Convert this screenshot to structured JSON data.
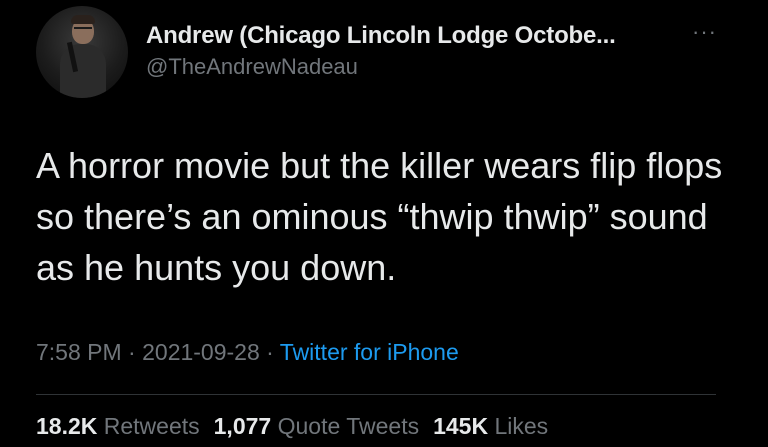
{
  "author": {
    "display_name": "Andrew (Chicago Lincoln Lodge Octobe...",
    "handle": "@TheAndrewNadeau"
  },
  "more_icon": "more-horizontal-icon",
  "tweet": {
    "text": "A horror movie but the killer wears flip flops so there’s an ominous “thwip thwip” sound as he hunts you down."
  },
  "meta": {
    "time": "7:58 PM",
    "sep1": " · ",
    "date": "2021-09-28",
    "sep2": " · ",
    "source": "Twitter for iPhone"
  },
  "stats": {
    "retweets_count": "18.2K",
    "retweets_label": "Retweets",
    "quotes_count": "1,077",
    "quotes_label": "Quote Tweets",
    "likes_count": "145K",
    "likes_label": "Likes"
  },
  "colors": {
    "background": "#000000",
    "primary_text": "#e7e9ea",
    "secondary_text": "#71767b",
    "link": "#1d9bf0"
  }
}
